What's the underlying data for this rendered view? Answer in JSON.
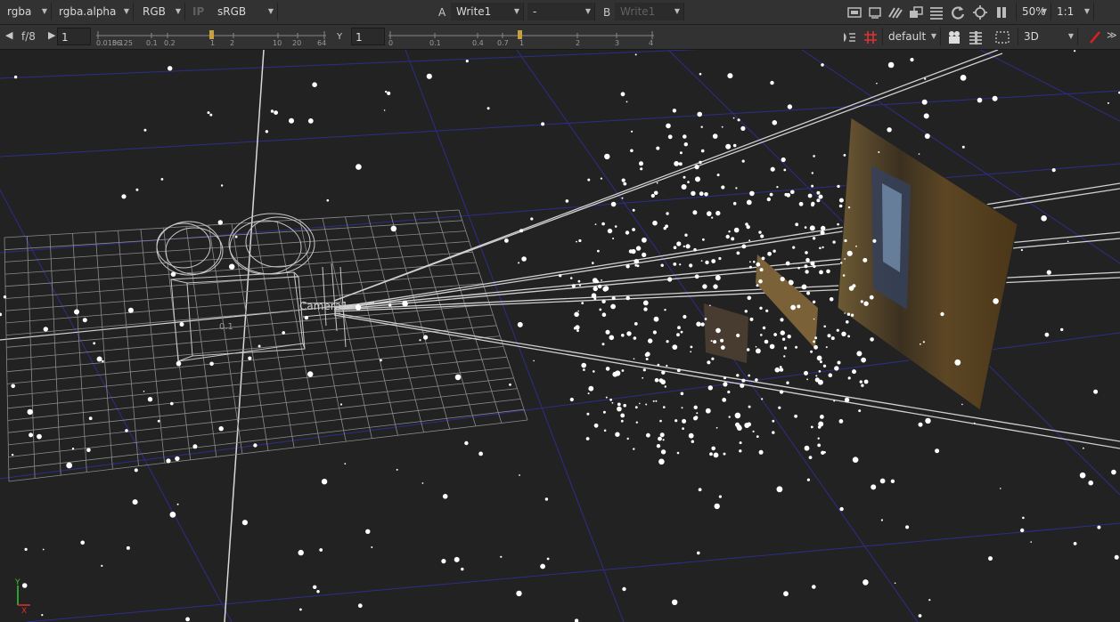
{
  "top_bar": {
    "channels": "rgba",
    "alpha": "rgba.alpha",
    "display_channels": "RGB",
    "ip_label": "IP",
    "colorspace": "sRGB",
    "a_label": "A",
    "a_input": "Write1",
    "composite_op": "-",
    "b_label": "B",
    "b_input": "Write1",
    "zoom": "50%",
    "proxy": "1:1"
  },
  "sub_bar": {
    "fstop": "f/8",
    "gain_value": "1",
    "gain_ticks": [
      "0.0156",
      "0.125",
      "0.1",
      "0.2",
      "1",
      "2",
      "10",
      "20",
      "64"
    ],
    "gamma_label": "Y",
    "gamma_value": "1",
    "gamma_ticks": [
      "0",
      "0.1",
      "0.4",
      "0.7",
      "1",
      "2",
      "3",
      "4"
    ],
    "lut": "default",
    "view_mode": "3D"
  },
  "viewport": {
    "camera_label": "Camera1",
    "camera_scale": "0.1",
    "axis_y": "Y",
    "axis_x": "X"
  },
  "colors": {
    "bar_bg": "#323232",
    "viewport_bg": "#222222",
    "grid_line": "#2d2d8a",
    "paint_accent": "#e02020"
  },
  "icons": [
    "prev-arrow-icon",
    "next-arrow-icon",
    "gamma-arrow-icon",
    "frame-icon",
    "monitor-icon",
    "wipe-icon",
    "overlay-icon",
    "lines-icon",
    "refresh-icon",
    "clip-icon",
    "pause-icon",
    "lighting-icon",
    "hash-icon",
    "camera-icon",
    "stack-icon",
    "roi-icon",
    "paint-icon",
    "collapse-icon"
  ]
}
